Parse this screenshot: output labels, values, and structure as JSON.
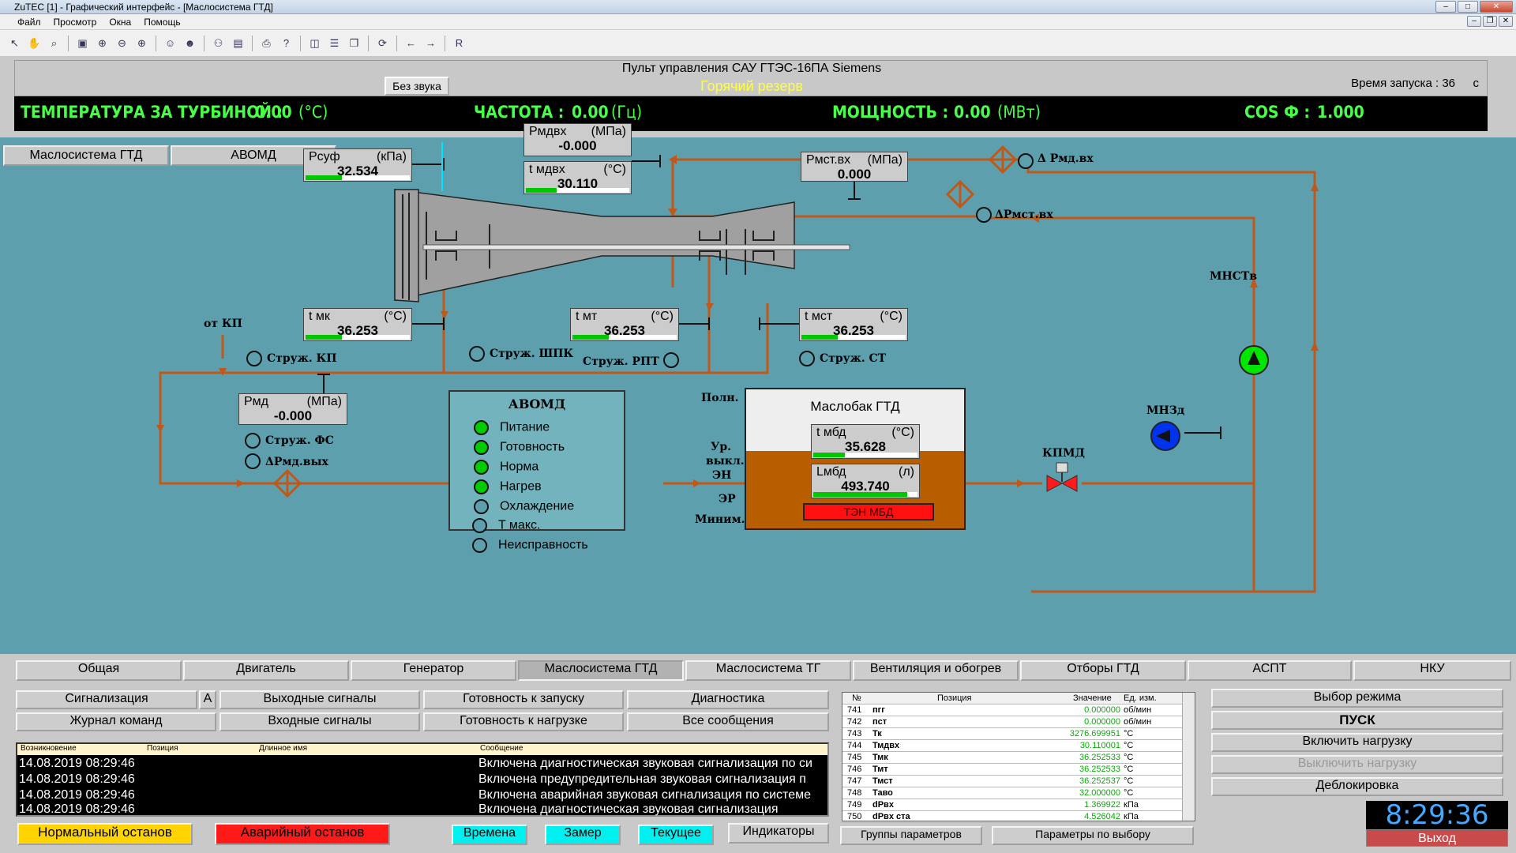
{
  "window": {
    "title": "ZuTEC [1] - Графический интерфейс - [Маслосистема ГТД]",
    "menu": [
      "Файл",
      "Просмотр",
      "Окна",
      "Помощь"
    ]
  },
  "header": {
    "title": "Пульт управления САУ ГТЭС-16ПА Siemens",
    "sound_button": "Без звука",
    "mode": "Горячий резерв",
    "launch_time_label": "Время запуска :",
    "launch_time_value": "36",
    "launch_time_unit": "с"
  },
  "measurements": [
    {
      "label": "ТЕМПЕРАТУРА ЗА ТУРБИНОЙ :",
      "value": "0.00",
      "unit": "(°C)"
    },
    {
      "label": "ЧАСТОТА :",
      "value": "0.00",
      "unit": "(Гц)"
    },
    {
      "label": "МОЩНОСТЬ :",
      "value": "0.00",
      "unit": "(МВт)"
    },
    {
      "label": "COS Ф :",
      "value": "1.000",
      "unit": ""
    }
  ],
  "diagram_tabs": [
    "Маслосистема ГТД",
    "АВОМД"
  ],
  "params": {
    "rsuf": {
      "label": "Pсуф",
      "unit": "(кПа)",
      "value": "32.534",
      "level": 0.35
    },
    "rmdvh": {
      "label": "Pмдвх",
      "unit": "(МПа)",
      "value": "-0.000",
      "level": 0
    },
    "tmdvh": {
      "label": "t мдвх",
      "unit": "(°C)",
      "value": "30.110",
      "level": 0.3
    },
    "rmstvh": {
      "label": "Pмст.вх",
      "unit": "(МПа)",
      "value": "0.000",
      "level": 0
    },
    "tmk": {
      "label": "t мк",
      "unit": "(°C)",
      "value": "36.253",
      "level": 0.35
    },
    "tmt": {
      "label": "t мт",
      "unit": "(°C)",
      "value": "36.253",
      "level": 0.35
    },
    "tmst": {
      "label": "t мст",
      "unit": "(°C)",
      "value": "36.253",
      "level": 0.35
    },
    "rmd": {
      "label": "Pмд",
      "unit": "(МПа)",
      "value": "-0.000",
      "level": 0
    },
    "tmbd": {
      "label": "t мбд",
      "unit": "(°C)",
      "value": "35.628",
      "level": 0.3
    },
    "lmbd": {
      "label": "Lмбд",
      "unit": "(л)",
      "value": "493.740",
      "level": 0.9
    }
  },
  "labels": {
    "d_rmd_vh": "Δ Pмд.вх",
    "d_rmst_vh": "ΔPмст.вх",
    "mnstv": "МНСТв",
    "ot_kp": "от КП",
    "struzh_kp": "Струж. КП",
    "struzh_shpk": "Струж. ШПК",
    "struzh_rpt": "Струж. РПТ",
    "struzh_st": "Струж. СТ",
    "struzh_fs": "Струж. ФС",
    "d_rmd_vyh": "ΔPмд.вых",
    "mnzd": "МНЗд",
    "kpmd": "КПМД",
    "poln": "Полн.",
    "ur_vykl": "Ур.",
    "ur_vykl2": "выкл.",
    "ur_vykl3": "ЭН",
    "er": "ЭР",
    "minim": "Миним."
  },
  "avomd": {
    "title": "АВОМД",
    "items": [
      {
        "label": "Питание",
        "on": true
      },
      {
        "label": "Готовность",
        "on": true
      },
      {
        "label": "Норма",
        "on": true
      },
      {
        "label": "Нагрев",
        "on": true
      },
      {
        "label": "Охлаждение",
        "on": false
      },
      {
        "label": "T макс.",
        "on": false
      },
      {
        "label": "Неисправность",
        "on": false
      }
    ]
  },
  "tank": {
    "title": "Маслобак ГТД",
    "heater": "ТЭН МБД"
  },
  "nav_tabs": [
    "Общая",
    "Двигатель",
    "Генератор",
    "Маслосистема ГТД",
    "Маслосистема ТГ",
    "Вентиляция и обогрев",
    "Отборы ГТД",
    "АСПТ",
    "НКУ"
  ],
  "func_buttons": {
    "signal": "Сигнализация",
    "a": "A",
    "out": "Выходные сигналы",
    "ready_start": "Готовность к запуску",
    "diag": "Диагностика",
    "journal": "Журнал команд",
    "in": "Входные сигналы",
    "ready_load": "Готовность к нагрузке",
    "all_msgs": "Все сообщения"
  },
  "messages": {
    "headers": [
      "Возникновение",
      "Позиция",
      "Длинное имя",
      "Сообщение"
    ],
    "rows": [
      {
        "time": "14.08.2019 08:29:46",
        "text": "Включена диагностическая звуковая сигнализация по си"
      },
      {
        "time": "14.08.2019 08:29:46",
        "text": "Включена предупредительная звуковая сигнализация п"
      },
      {
        "time": "14.08.2019 08:29:46",
        "text": "Включена аварийная звуковая сигнализация по системе"
      },
      {
        "time": "14.08.2019 08:29:46",
        "text": "Включена диагностическая звуковая сигнализация"
      }
    ]
  },
  "param_table": {
    "headers": [
      "№",
      "Позиция",
      "Значение",
      "Ед. изм."
    ],
    "rows": [
      {
        "n": "741",
        "pos": "пгг",
        "val": "0.000000",
        "unit": "об/мин"
      },
      {
        "n": "742",
        "pos": "пст",
        "val": "0.000000",
        "unit": "об/мин"
      },
      {
        "n": "743",
        "pos": "Тк",
        "val": "3276.699951",
        "unit": "°C"
      },
      {
        "n": "744",
        "pos": "Тмдвх",
        "val": "30.110001",
        "unit": "°C"
      },
      {
        "n": "745",
        "pos": "Тмк",
        "val": "36.252533",
        "unit": "°C"
      },
      {
        "n": "746",
        "pos": "Тмт",
        "val": "36.252533",
        "unit": "°C"
      },
      {
        "n": "747",
        "pos": "Тмст",
        "val": "36.252537",
        "unit": "°C"
      },
      {
        "n": "748",
        "pos": "Таво",
        "val": "32.000000",
        "unit": "°C"
      },
      {
        "n": "749",
        "pos": "dPвх",
        "val": "1.369922",
        "unit": "кПа"
      },
      {
        "n": "750",
        "pos": "dPвх ста",
        "val": "4.526042",
        "unit": "кПа"
      }
    ]
  },
  "right_buttons": [
    "Выбор режима",
    "ПУСК",
    "Включить нагрузку",
    "Выключить нагрузку",
    "Деблокировка"
  ],
  "bottom_buttons": {
    "normal_stop": "Нормальный останов",
    "emergency_stop": "Аварийный останов",
    "times": "Времена",
    "zamer": "Замер",
    "current": "Текущее",
    "indicators": "Индикаторы",
    "param_groups": "Группы параметров",
    "params_choice": "Параметры по выбору"
  },
  "clock": "8:29:36",
  "exit": "Выход"
}
